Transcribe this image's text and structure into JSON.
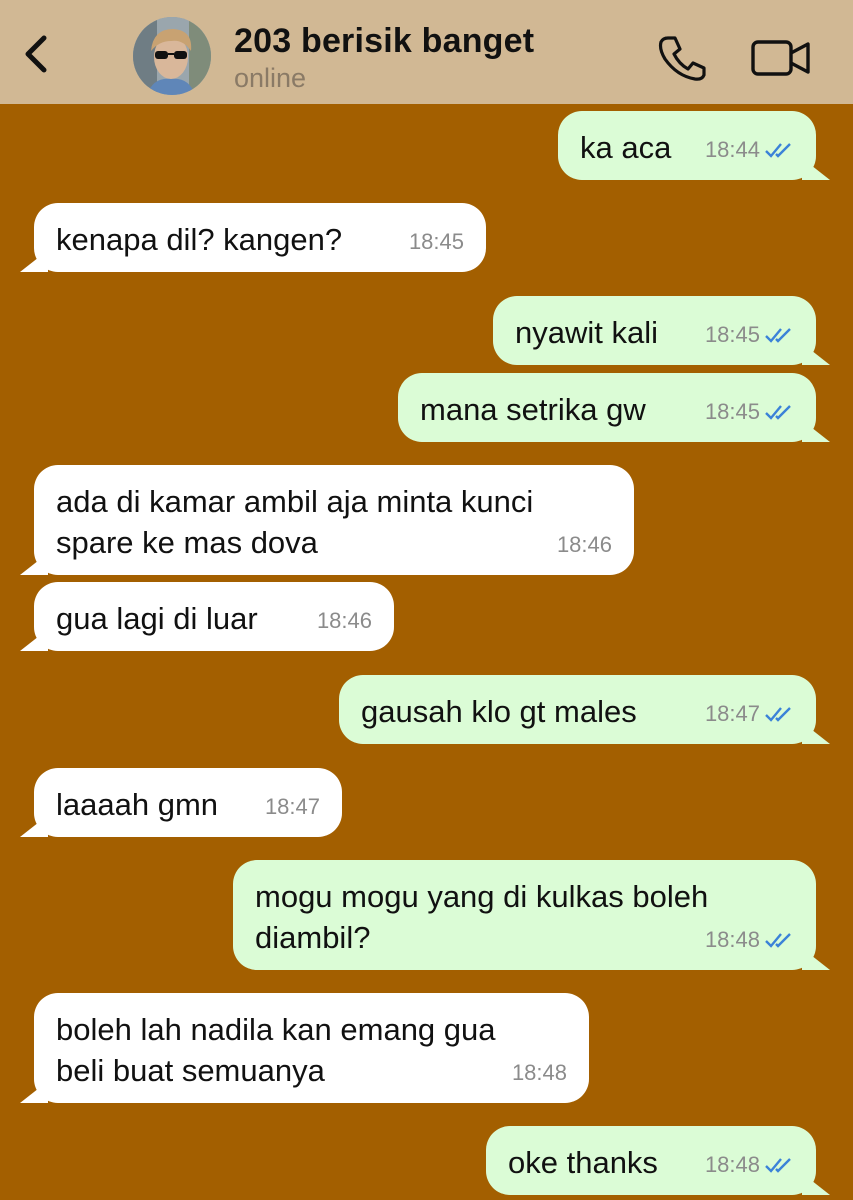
{
  "header": {
    "title": "203 berisik banget",
    "status": "online"
  },
  "colors": {
    "background": "#a35f00",
    "header": "#d1b894",
    "outgoing_bubble": "#dbfcd6",
    "incoming_bubble": "#ffffff",
    "read_ticks": "#3b82d8"
  },
  "icons": {
    "back": "chevron-left-icon",
    "call": "phone-icon",
    "video": "video-camera-icon",
    "read": "double-check-icon"
  },
  "messages": [
    {
      "dir": "out",
      "text": "ka aca",
      "time": "18:44",
      "read": true
    },
    {
      "dir": "in",
      "text": "kenapa dil? kangen?",
      "time": "18:45"
    },
    {
      "dir": "out",
      "text": "nyawit kali",
      "time": "18:45",
      "read": true
    },
    {
      "dir": "out",
      "text": "mana setrika gw",
      "time": "18:45",
      "read": true
    },
    {
      "dir": "in",
      "text": "ada di kamar ambil aja minta kunci\nspare ke mas dova",
      "time": "18:46"
    },
    {
      "dir": "in",
      "text": "gua lagi di luar",
      "time": "18:46"
    },
    {
      "dir": "out",
      "text": "gausah klo gt males",
      "time": "18:47",
      "read": true
    },
    {
      "dir": "in",
      "text": "laaaah gmn",
      "time": "18:47"
    },
    {
      "dir": "out",
      "text": "mogu mogu yang di kulkas boleh\ndiambil?",
      "time": "18:48",
      "read": true
    },
    {
      "dir": "in",
      "text": "boleh lah nadila kan emang gua\nbeli buat semuanya",
      "time": "18:48"
    },
    {
      "dir": "out",
      "text": "oke thanks",
      "time": "18:48",
      "read": true
    }
  ]
}
